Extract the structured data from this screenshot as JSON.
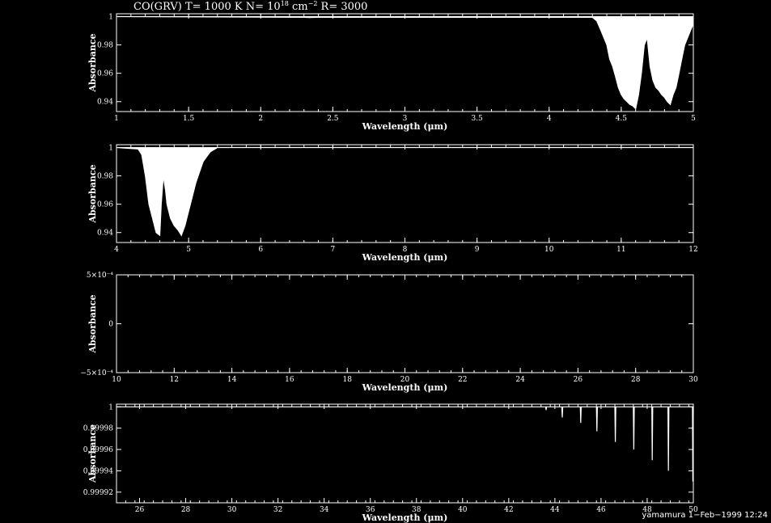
{
  "title": {
    "prefix": "CO(GRV) T= 1000 K N= 10",
    "exponent": "18",
    "middle": " cm",
    "exponent2": "−2",
    "suffix": " R= 3000"
  },
  "footer": "yamamura  1−Feb−1999 12:24",
  "colors": {
    "background": "#000000",
    "foreground": "#ffffff"
  },
  "chart_data": [
    {
      "type": "line",
      "xlabel": "Wavelength (μm)",
      "ylabel": "Absorbance",
      "xlim": [
        1,
        5
      ],
      "ylim": [
        0.933,
        1.002
      ],
      "xticks": [
        1,
        1.5,
        2,
        2.5,
        3,
        3.5,
        4,
        4.5,
        5
      ],
      "xtick_labels": [
        "1",
        "1.5",
        "2",
        "2.5",
        "3",
        "3.5",
        "4",
        "4.5",
        "5"
      ],
      "yticks": [
        0.94,
        0.96,
        0.98,
        1
      ],
      "ytick_labels": [
        "0.94",
        "0.96",
        "0.98",
        "1"
      ],
      "series": [
        {
          "x": [
            1,
            2.3,
            2.34,
            2.4,
            4.3,
            4.33,
            4.36,
            4.38,
            4.4,
            4.42,
            4.44,
            4.46,
            4.48,
            4.5,
            4.52,
            4.54,
            4.56,
            4.58,
            4.6,
            4.62,
            4.64,
            4.66,
            4.68,
            4.7,
            4.72,
            4.74,
            4.76,
            4.78,
            4.8,
            4.82,
            4.84,
            4.86,
            4.88,
            4.9,
            4.92,
            4.94,
            4.96,
            4.98,
            5
          ],
          "y": [
            1,
            0.9995,
            0.9993,
            0.9995,
            0.9995,
            0.997,
            0.99,
            0.985,
            0.98,
            0.97,
            0.965,
            0.958,
            0.95,
            0.945,
            0.942,
            0.94,
            0.938,
            0.937,
            0.935,
            0.945,
            0.96,
            0.98,
            0.985,
            0.965,
            0.955,
            0.95,
            0.948,
            0.945,
            0.943,
            0.94,
            0.938,
            0.945,
            0.95,
            0.96,
            0.97,
            0.98,
            0.985,
            0.99,
            0.995
          ]
        }
      ]
    },
    {
      "type": "line",
      "xlabel": "Wavelength (μm)",
      "ylabel": "Absorbance",
      "xlim": [
        4,
        12
      ],
      "ylim": [
        0.933,
        1.002
      ],
      "xticks": [
        4,
        5,
        6,
        7,
        8,
        9,
        10,
        11,
        12
      ],
      "xtick_labels": [
        "4",
        "5",
        "6",
        "7",
        "8",
        "9",
        "10",
        "11",
        "12"
      ],
      "yticks": [
        0.94,
        0.96,
        0.98,
        1
      ],
      "ytick_labels": [
        "0.94",
        "0.96",
        "0.98",
        "1"
      ],
      "series": [
        {
          "x": [
            4,
            4.3,
            4.35,
            4.4,
            4.45,
            4.5,
            4.55,
            4.6,
            4.62,
            4.65,
            4.68,
            4.7,
            4.75,
            4.8,
            4.85,
            4.9,
            4.95,
            5.0,
            5.05,
            5.1,
            5.2,
            5.3,
            5.4,
            12
          ],
          "y": [
            1,
            0.999,
            0.995,
            0.98,
            0.96,
            0.95,
            0.94,
            0.938,
            0.96,
            0.98,
            0.97,
            0.96,
            0.95,
            0.945,
            0.942,
            0.938,
            0.945,
            0.955,
            0.965,
            0.975,
            0.99,
            0.997,
            1,
            1
          ]
        }
      ]
    },
    {
      "type": "line",
      "xlabel": "Wavelength (μm)",
      "ylabel": "Absorbance",
      "xlim": [
        10,
        30
      ],
      "ylim": [
        -0.0005,
        0.0005
      ],
      "xticks": [
        10,
        12,
        14,
        16,
        18,
        20,
        22,
        24,
        26,
        28,
        30
      ],
      "xtick_labels": [
        "10",
        "12",
        "14",
        "16",
        "18",
        "20",
        "22",
        "24",
        "26",
        "28",
        "30"
      ],
      "ytick_labels": [
        "5×10⁻⁴",
        "0",
        "−5×10⁻⁴"
      ],
      "yticks": [
        0.0005,
        0,
        -0.0005
      ],
      "series": [
        {
          "x": [],
          "y": []
        }
      ]
    },
    {
      "type": "line",
      "xlabel": "Wavelength (μm)",
      "ylabel": "Absorbance",
      "xlim": [
        25,
        50
      ],
      "ylim": [
        0.99991,
        1.0000025
      ],
      "xticks": [
        26,
        28,
        30,
        32,
        34,
        36,
        38,
        40,
        42,
        44,
        46,
        48,
        50
      ],
      "xtick_labels": [
        "26",
        "28",
        "30",
        "32",
        "34",
        "36",
        "38",
        "40",
        "42",
        "44",
        "46",
        "48",
        "50"
      ],
      "yticks": [
        0.99992,
        0.99994,
        0.99996,
        0.99998,
        1
      ],
      "ytick_labels": [
        "0.99992",
        "0.99994",
        "0.99996",
        "0.99998",
        "1"
      ],
      "series": [
        {
          "x": [
            25,
            43.6,
            43.62,
            43.64,
            44.3,
            44.32,
            44.34,
            45.1,
            45.12,
            45.14,
            45.8,
            45.82,
            45.84,
            46.6,
            46.62,
            46.64,
            47.4,
            47.42,
            47.44,
            48.2,
            48.22,
            48.24,
            48.9,
            48.92,
            48.94,
            49.96,
            49.98,
            50
          ],
          "y": [
            1,
            1,
            0.999997,
            1,
            1,
            0.99999,
            1,
            1,
            0.999985,
            1,
            1,
            0.999977,
            1,
            1,
            0.999967,
            1,
            1,
            0.99996,
            1,
            1,
            0.99995,
            1,
            1,
            0.99994,
            1,
            1,
            0.99993,
            1
          ]
        }
      ]
    }
  ]
}
